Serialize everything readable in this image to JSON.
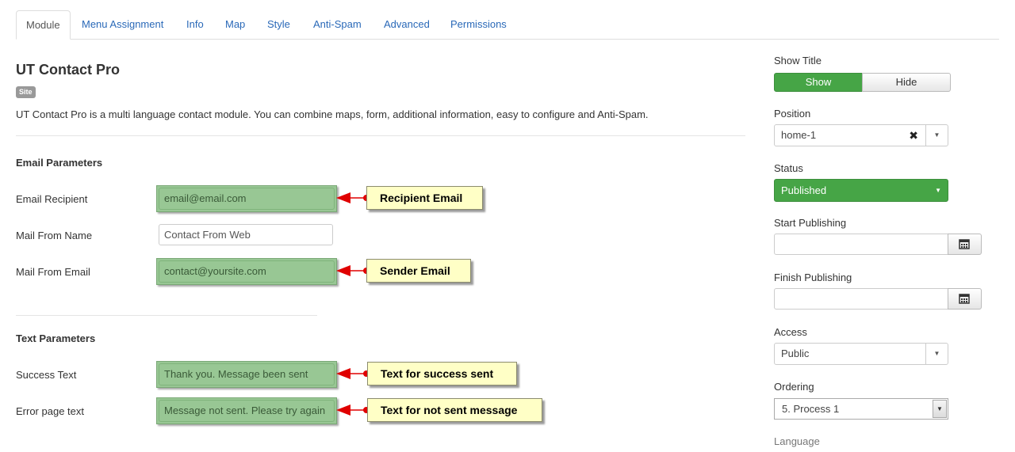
{
  "tabs": [
    {
      "label": "Module"
    },
    {
      "label": "Menu Assignment"
    },
    {
      "label": "Info"
    },
    {
      "label": "Map"
    },
    {
      "label": "Style"
    },
    {
      "label": "Anti-Spam"
    },
    {
      "label": "Advanced"
    },
    {
      "label": "Permissions"
    }
  ],
  "module": {
    "title": "UT Contact Pro",
    "badge": "Site",
    "description": "UT Contact Pro is a multi language contact module. You can combine maps, form, additional information, easy to configure and Anti-Spam."
  },
  "email_params": {
    "heading": "Email Parameters",
    "recipient_label": "Email Recipient",
    "recipient_value": "email@email.com",
    "from_name_label": "Mail From Name",
    "from_name_value": "Contact From Web",
    "from_email_label": "Mail From Email",
    "from_email_value": "contact@yoursite.com"
  },
  "text_params": {
    "heading": "Text Parameters",
    "success_label": "Success Text",
    "success_value": "Thank you. Message been sent",
    "error_label": "Error page text",
    "error_value": "Message not sent. Please try again"
  },
  "callouts": {
    "recipient": "Recipient Email",
    "sender": "Sender Email",
    "success": "Text for success sent",
    "error": "Text for not sent message"
  },
  "sidebar": {
    "show_title_label": "Show Title",
    "show_label": "Show",
    "hide_label": "Hide",
    "position_label": "Position",
    "position_value": "home-1",
    "status_label": "Status",
    "status_value": "Published",
    "start_publishing_label": "Start Publishing",
    "finish_publishing_label": "Finish Publishing",
    "access_label": "Access",
    "access_value": "Public",
    "ordering_label": "Ordering",
    "ordering_value": "5. Process 1",
    "language_label": "Language"
  },
  "colors": {
    "accent_blue": "#2a69b8",
    "success_green": "#46a546",
    "highlight_green": "#98c794",
    "callout_yellow": "#ffffc6",
    "arrow_red": "#e00000"
  }
}
